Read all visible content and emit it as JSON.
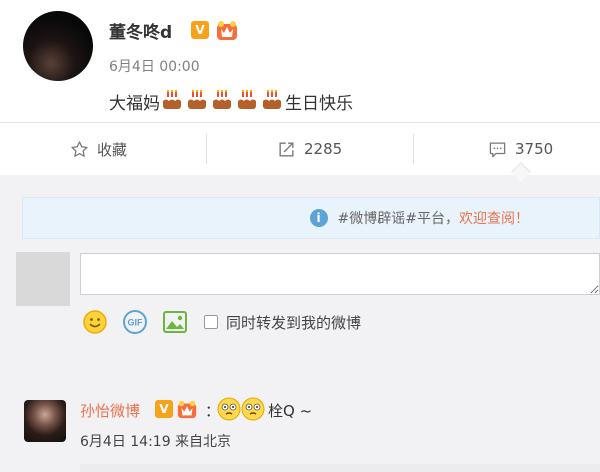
{
  "post": {
    "username": "董冬咚d",
    "verified_badge": "V",
    "time": "6月4日 00:00",
    "text_before": "大福妈",
    "cake_count": 5,
    "text_after": "生日快乐"
  },
  "actions": {
    "favorite_label": "收藏",
    "repost_count": "2285",
    "comment_count": "3750"
  },
  "notice": {
    "text": "#微博辟谣#平台，",
    "link": "欢迎查阅！"
  },
  "composer": {
    "input_value": "",
    "checkbox_label": "同时转发到我的微博",
    "checked": false,
    "tools": [
      "smile-icon",
      "gif-icon",
      "image-icon"
    ]
  },
  "reply": {
    "username": "孙怡微博",
    "verified_badge": "V",
    "colon": "：",
    "text": "栓Q ~",
    "meta": "6月4日 14:19 来自北京"
  },
  "colors": {
    "accent_orange": "#eb7350",
    "badge_gold": "#f6a31b",
    "info_blue": "#5ca3d6"
  }
}
